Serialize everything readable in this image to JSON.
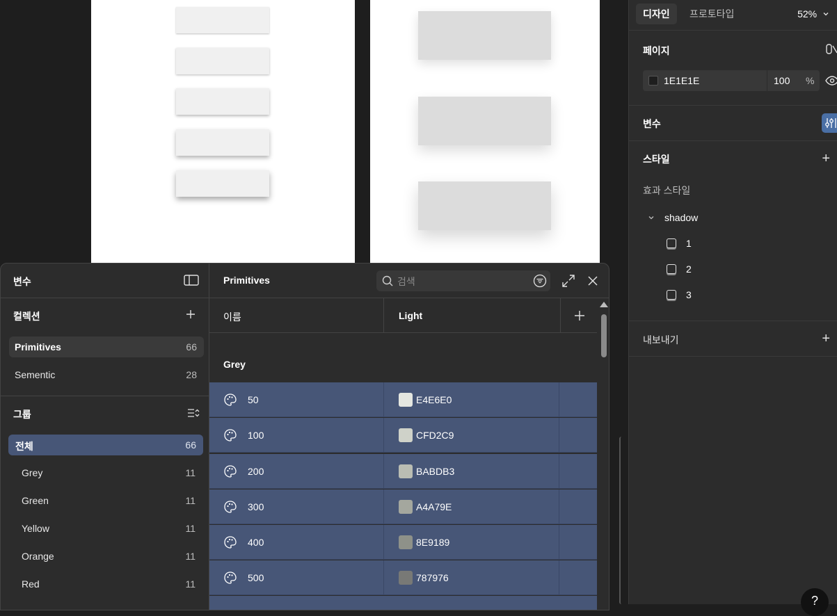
{
  "design_panel": {
    "tabs": [
      "디자인",
      "프로토타입"
    ],
    "zoom": "52%",
    "page": {
      "title": "페이지",
      "color_hex": "1E1E1E",
      "opacity": "100",
      "opacity_unit": "%"
    },
    "variables_title": "변수",
    "styles": {
      "title": "스타일",
      "effect_styles_label": "효과 스타일",
      "group_name": "shadow",
      "items": [
        "1",
        "2",
        "3"
      ]
    },
    "export_title": "내보내기",
    "help_label": "?"
  },
  "variables_modal": {
    "title": "변수",
    "collections_title": "컬렉션",
    "collections": [
      {
        "name": "Primitives",
        "count": "66"
      },
      {
        "name": "Sementic",
        "count": "28"
      }
    ],
    "groups_title": "그룹",
    "groups_all": {
      "name": "전체",
      "count": "66"
    },
    "groups": [
      {
        "name": "Grey",
        "count": "11"
      },
      {
        "name": "Green",
        "count": "11"
      },
      {
        "name": "Yellow",
        "count": "11"
      },
      {
        "name": "Orange",
        "count": "11"
      },
      {
        "name": "Red",
        "count": "11"
      }
    ],
    "main_title": "Primitives",
    "search_placeholder": "검색",
    "columns": {
      "name": "이름",
      "mode": "Light"
    },
    "current_group": "Grey",
    "rows": [
      {
        "name": "50",
        "hex": "E4E6E0",
        "color": "#E4E6E0"
      },
      {
        "name": "100",
        "hex": "CFD2C9",
        "color": "#CFD2C9"
      },
      {
        "name": "200",
        "hex": "BABDB3",
        "color": "#BABDB3"
      },
      {
        "name": "300",
        "hex": "A4A79E",
        "color": "#A4A79E"
      },
      {
        "name": "400",
        "hex": "8E9189",
        "color": "#8E9189"
      },
      {
        "name": "500",
        "hex": "787976",
        "color": "#787976"
      }
    ]
  }
}
